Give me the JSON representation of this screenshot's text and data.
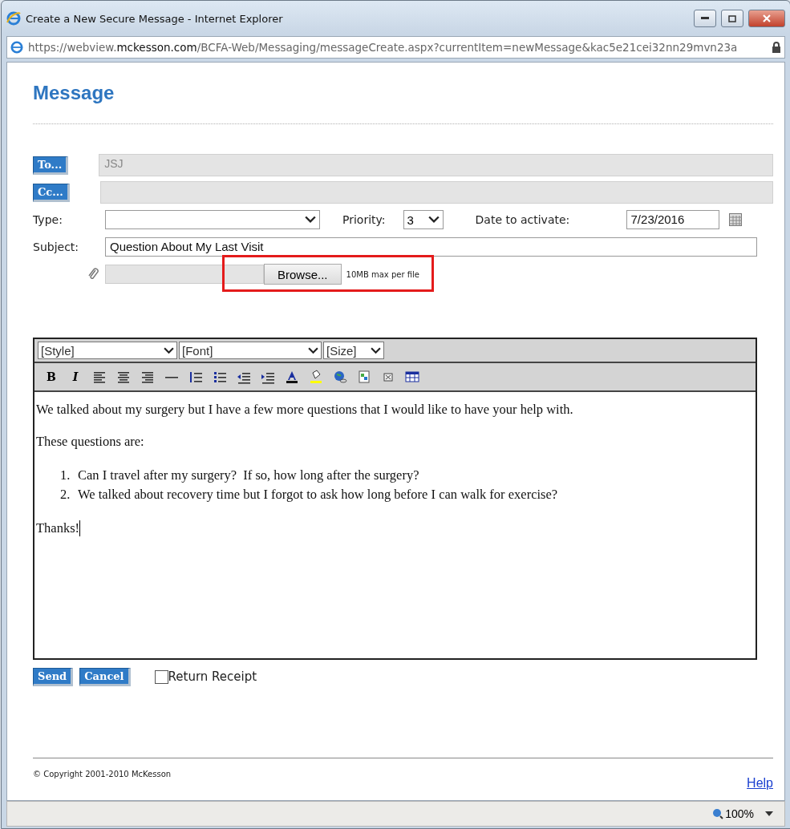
{
  "window": {
    "title": "Create a New Secure Message - Internet Explorer",
    "url": "https://webview.**mckesson.com**/BCFA-Web/Messaging/messageCreate.aspx?currentItem=newMessage&kac5e21cei32nn29mvn23a"
  },
  "page_title": "Message",
  "to": {
    "button": "To...",
    "value": "JSJ"
  },
  "cc": {
    "button": "Cc..."
  },
  "type": {
    "label": "Type:"
  },
  "priority": {
    "label": "Priority:",
    "value": "3"
  },
  "date": {
    "label": "Date to activate:",
    "value": "7/23/2016"
  },
  "subject": {
    "label": "Subject:",
    "value": "Question About My Last Visit"
  },
  "attachment": {
    "button": "Browse...",
    "note": "10MB max per file",
    "highlighted": true
  },
  "editor": {
    "selects": [
      "[Style]",
      "[Font]",
      "[Size]"
    ],
    "bold": "B",
    "italic": "I",
    "intro": "We talked about my surgery but I have a few more questions that I would like to have your help with.",
    "lead": "These questions are:",
    "questions": [
      {
        "number": "1.",
        "text": "Can I travel after my surgery?  If so, how long after the surgery?"
      },
      {
        "number": "2.",
        "text": "We talked about recovery time but I forgot to ask how long before I can walk for exercise?"
      }
    ],
    "closing": "Thanks!"
  },
  "actions": {
    "send": "Send",
    "cancel": "Cancel",
    "receipt": {
      "label": "Return Receipt",
      "checked": false
    }
  },
  "footer": {
    "copyright": "© Copyright 2001-2010 McKesson",
    "help": "Help"
  },
  "status_bar": {
    "zoom": "100%"
  }
}
